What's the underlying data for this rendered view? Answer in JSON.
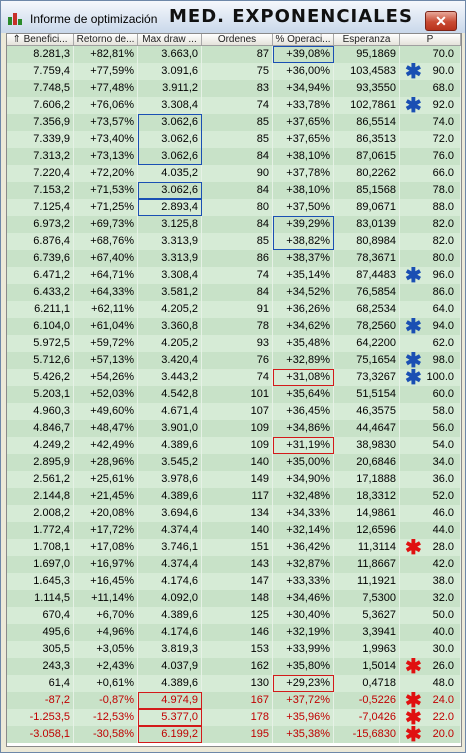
{
  "window": {
    "title": "Informe de optimización",
    "overlay_title": "MED. EXPONENCIALES",
    "close_label": "✕"
  },
  "columns": [
    "⇑ Benefici...",
    "Retorno de...",
    "Max draw ...",
    "Ordenes",
    "% Operaci...",
    "Esperanza",
    "P"
  ],
  "rows": [
    {
      "cells": [
        "8.281,3",
        "+82,81%",
        "3.663,0",
        "87",
        "+39,08%",
        "95,1869",
        "70.0"
      ],
      "neg": false,
      "mark": ""
    },
    {
      "cells": [
        "7.759,4",
        "+77,59%",
        "3.091,6",
        "75",
        "+36,00%",
        "103,4583",
        "90.0"
      ],
      "neg": false,
      "mark": "blue"
    },
    {
      "cells": [
        "7.748,5",
        "+77,48%",
        "3.911,2",
        "83",
        "+34,94%",
        "93,3550",
        "68.0"
      ],
      "neg": false,
      "mark": ""
    },
    {
      "cells": [
        "7.606,2",
        "+76,06%",
        "3.308,4",
        "74",
        "+33,78%",
        "102,7861",
        "92.0"
      ],
      "neg": false,
      "mark": "blue"
    },
    {
      "cells": [
        "7.356,9",
        "+73,57%",
        "3.062,6",
        "85",
        "+37,65%",
        "86,5514",
        "74.0"
      ],
      "neg": false,
      "mark": ""
    },
    {
      "cells": [
        "7.339,9",
        "+73,40%",
        "3.062,6",
        "85",
        "+37,65%",
        "86,3513",
        "72.0"
      ],
      "neg": false,
      "mark": ""
    },
    {
      "cells": [
        "7.313,2",
        "+73,13%",
        "3.062,6",
        "84",
        "+38,10%",
        "87,0615",
        "76.0"
      ],
      "neg": false,
      "mark": ""
    },
    {
      "cells": [
        "7.220,4",
        "+72,20%",
        "4.035,2",
        "90",
        "+37,78%",
        "80,2262",
        "66.0"
      ],
      "neg": false,
      "mark": ""
    },
    {
      "cells": [
        "7.153,2",
        "+71,53%",
        "3.062,6",
        "84",
        "+38,10%",
        "85,1568",
        "78.0"
      ],
      "neg": false,
      "mark": ""
    },
    {
      "cells": [
        "7.125,4",
        "+71,25%",
        "2.893,4",
        "80",
        "+37,50%",
        "89,0671",
        "88.0"
      ],
      "neg": false,
      "mark": ""
    },
    {
      "cells": [
        "6.973,2",
        "+69,73%",
        "3.125,8",
        "84",
        "+39,29%",
        "83,0139",
        "82.0"
      ],
      "neg": false,
      "mark": ""
    },
    {
      "cells": [
        "6.876,4",
        "+68,76%",
        "3.313,9",
        "85",
        "+38,82%",
        "80,8984",
        "82.0"
      ],
      "neg": false,
      "mark": ""
    },
    {
      "cells": [
        "6.739,6",
        "+67,40%",
        "3.313,9",
        "86",
        "+38,37%",
        "78,3671",
        "80.0"
      ],
      "neg": false,
      "mark": ""
    },
    {
      "cells": [
        "6.471,2",
        "+64,71%",
        "3.308,4",
        "74",
        "+35,14%",
        "87,4483",
        "96.0"
      ],
      "neg": false,
      "mark": "blue"
    },
    {
      "cells": [
        "6.433,2",
        "+64,33%",
        "3.581,2",
        "84",
        "+34,52%",
        "76,5854",
        "86.0"
      ],
      "neg": false,
      "mark": ""
    },
    {
      "cells": [
        "6.211,1",
        "+62,11%",
        "4.205,2",
        "91",
        "+36,26%",
        "68,2534",
        "64.0"
      ],
      "neg": false,
      "mark": ""
    },
    {
      "cells": [
        "6.104,0",
        "+61,04%",
        "3.360,8",
        "78",
        "+34,62%",
        "78,2560",
        "94.0"
      ],
      "neg": false,
      "mark": "blue"
    },
    {
      "cells": [
        "5.972,5",
        "+59,72%",
        "4.205,2",
        "93",
        "+35,48%",
        "64,2200",
        "62.0"
      ],
      "neg": false,
      "mark": ""
    },
    {
      "cells": [
        "5.712,6",
        "+57,13%",
        "3.420,4",
        "76",
        "+32,89%",
        "75,1654",
        "98.0"
      ],
      "neg": false,
      "mark": "blue"
    },
    {
      "cells": [
        "5.426,2",
        "+54,26%",
        "3.443,2",
        "74",
        "+31,08%",
        "73,3267",
        "100.0"
      ],
      "neg": false,
      "mark": "blue"
    },
    {
      "cells": [
        "5.203,1",
        "+52,03%",
        "4.542,8",
        "101",
        "+35,64%",
        "51,5154",
        "60.0"
      ],
      "neg": false,
      "mark": ""
    },
    {
      "cells": [
        "4.960,3",
        "+49,60%",
        "4.671,4",
        "107",
        "+36,45%",
        "46,3575",
        "58.0"
      ],
      "neg": false,
      "mark": ""
    },
    {
      "cells": [
        "4.846,7",
        "+48,47%",
        "3.901,0",
        "109",
        "+34,86%",
        "44,4647",
        "56.0"
      ],
      "neg": false,
      "mark": ""
    },
    {
      "cells": [
        "4.249,2",
        "+42,49%",
        "4.389,6",
        "109",
        "+31,19%",
        "38,9830",
        "54.0"
      ],
      "neg": false,
      "mark": ""
    },
    {
      "cells": [
        "2.895,9",
        "+28,96%",
        "3.545,2",
        "140",
        "+35,00%",
        "20,6846",
        "34.0"
      ],
      "neg": false,
      "mark": ""
    },
    {
      "cells": [
        "2.561,2",
        "+25,61%",
        "3.978,6",
        "149",
        "+34,90%",
        "17,1888",
        "36.0"
      ],
      "neg": false,
      "mark": ""
    },
    {
      "cells": [
        "2.144,8",
        "+21,45%",
        "4.389,6",
        "117",
        "+32,48%",
        "18,3312",
        "52.0"
      ],
      "neg": false,
      "mark": ""
    },
    {
      "cells": [
        "2.008,2",
        "+20,08%",
        "3.694,6",
        "134",
        "+34,33%",
        "14,9861",
        "46.0"
      ],
      "neg": false,
      "mark": ""
    },
    {
      "cells": [
        "1.772,4",
        "+17,72%",
        "4.374,4",
        "140",
        "+32,14%",
        "12,6596",
        "44.0"
      ],
      "neg": false,
      "mark": ""
    },
    {
      "cells": [
        "1.708,1",
        "+17,08%",
        "3.746,1",
        "151",
        "+36,42%",
        "11,3114",
        "28.0"
      ],
      "neg": false,
      "mark": "red"
    },
    {
      "cells": [
        "1.697,0",
        "+16,97%",
        "4.374,4",
        "143",
        "+32,87%",
        "11,8667",
        "42.0"
      ],
      "neg": false,
      "mark": ""
    },
    {
      "cells": [
        "1.645,3",
        "+16,45%",
        "4.174,6",
        "147",
        "+33,33%",
        "11,1921",
        "38.0"
      ],
      "neg": false,
      "mark": ""
    },
    {
      "cells": [
        "1.114,5",
        "+11,14%",
        "4.092,0",
        "148",
        "+34,46%",
        "7,5300",
        "32.0"
      ],
      "neg": false,
      "mark": ""
    },
    {
      "cells": [
        "670,4",
        "+6,70%",
        "4.389,6",
        "125",
        "+30,40%",
        "5,3627",
        "50.0"
      ],
      "neg": false,
      "mark": ""
    },
    {
      "cells": [
        "495,6",
        "+4,96%",
        "4.174,6",
        "146",
        "+32,19%",
        "3,3941",
        "40.0"
      ],
      "neg": false,
      "mark": ""
    },
    {
      "cells": [
        "305,5",
        "+3,05%",
        "3.819,3",
        "153",
        "+33,99%",
        "1,9963",
        "30.0"
      ],
      "neg": false,
      "mark": ""
    },
    {
      "cells": [
        "243,3",
        "+2,43%",
        "4.037,9",
        "162",
        "+35,80%",
        "1,5014",
        "26.0"
      ],
      "neg": false,
      "mark": "red"
    },
    {
      "cells": [
        "61,4",
        "+0,61%",
        "4.389,6",
        "130",
        "+29,23%",
        "0,4718",
        "48.0"
      ],
      "neg": false,
      "mark": ""
    },
    {
      "cells": [
        "-87,2",
        "-0,87%",
        "4.974,9",
        "167",
        "+37,72%",
        "-0,5226",
        "24.0"
      ],
      "neg": true,
      "mark": "red"
    },
    {
      "cells": [
        "-1.253,5",
        "-12,53%",
        "5.377,0",
        "178",
        "+35,96%",
        "-7,0426",
        "22.0"
      ],
      "neg": true,
      "mark": "red"
    },
    {
      "cells": [
        "-3.058,1",
        "-30,58%",
        "6.199,2",
        "195",
        "+35,38%",
        "-15,6830",
        "20.0"
      ],
      "neg": true,
      "mark": "red"
    }
  ],
  "marks": {
    "blue_star": "✱",
    "red_star": "✱"
  },
  "colors": {
    "row_a": "#c8e2c8",
    "row_b": "#d6ebd6",
    "negative": "#c00000",
    "blue_box": "#1a4fb3",
    "red_box": "#d31a1a"
  }
}
